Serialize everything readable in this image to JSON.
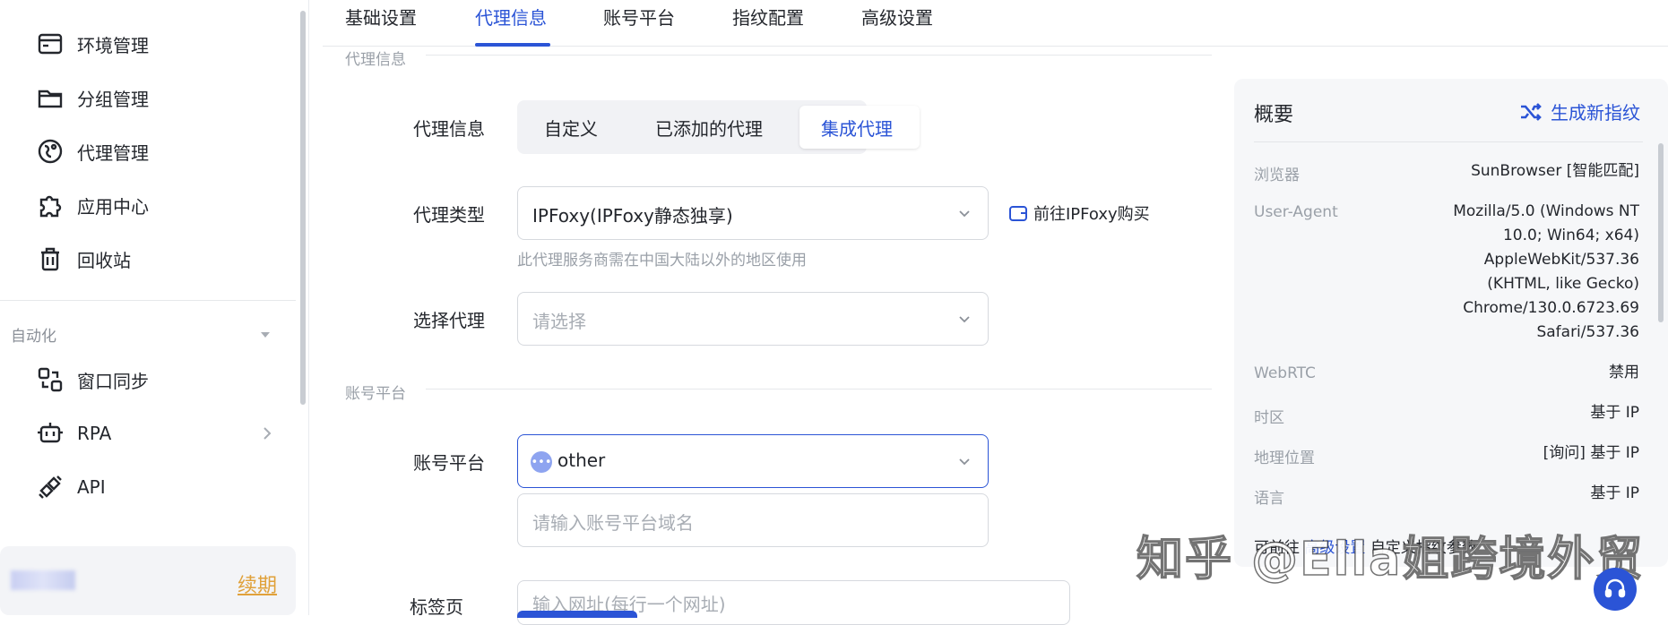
{
  "sidebar": {
    "items": [
      {
        "label": "环境管理",
        "icon": "browser-window-icon"
      },
      {
        "label": "分组管理",
        "icon": "folder-icon"
      },
      {
        "label": "代理管理",
        "icon": "proxy-globe-icon"
      },
      {
        "label": "应用中心",
        "icon": "puzzle-icon"
      },
      {
        "label": "回收站",
        "icon": "trash-icon"
      }
    ],
    "section_label": "自动化",
    "auto_items": [
      {
        "label": "窗口同步",
        "icon": "window-sync-icon"
      },
      {
        "label": "RPA",
        "icon": "robot-icon"
      },
      {
        "label": "API",
        "icon": "api-plug-icon"
      }
    ],
    "renew_label": "续期"
  },
  "tabs": [
    "基础设置",
    "代理信息",
    "账号平台",
    "指纹配置",
    "高级设置"
  ],
  "active_tab": "代理信息",
  "proxy_section": {
    "title": "代理信息",
    "proxy_info_label": "代理信息",
    "options": [
      "自定义",
      "已添加的代理",
      "集成代理"
    ],
    "selected_option": "集成代理",
    "proxy_type_label": "代理类型",
    "proxy_type_value": "IPFoxy(IPFoxy静态独享)",
    "buy_link": "前往IPFoxy购买",
    "hint": "此代理服务商需在中国大陆以外的地区使用",
    "select_proxy_label": "选择代理",
    "select_proxy_placeholder": "请选择"
  },
  "account_section": {
    "title": "账号平台",
    "platform_label": "账号平台",
    "platform_value": "other",
    "domain_placeholder": "请输入账号平台域名",
    "tab_page_label": "标签页",
    "tab_page_placeholder": "输入网址(每行一个网址)"
  },
  "overview": {
    "title": "概要",
    "generate_button": "生成新指纹",
    "rows": [
      {
        "key": "浏览器",
        "value": "SunBrowser [智能匹配]"
      },
      {
        "key": "User-Agent",
        "value": "Mozilla/5.0 (Windows NT 10.0; Win64; x64) AppleWebKit/537.36 (KHTML, like Gecko) Chrome/130.0.6723.69 Safari/537.36"
      },
      {
        "key": "WebRTC",
        "value": "禁用"
      },
      {
        "key": "时区",
        "value": "基于 IP"
      },
      {
        "key": "地理位置",
        "value": "[询问] 基于 IP"
      },
      {
        "key": "语言",
        "value": "基于 IP"
      }
    ],
    "ua_lines": [
      "Mozilla/5.0 (Windows NT",
      "10.0; Win64; x64)",
      "AppleWebKit/537.36",
      "(KHTML, like Gecko)",
      "Chrome/130.0.6723.69",
      "Safari/537.36"
    ],
    "footer_prefix": "可前往",
    "footer_link": "高级设置",
    "footer_suffix": "自定义指纹参数"
  },
  "watermark": "知乎 @Ella姐跨境外贸",
  "colors": {
    "accent": "#2b54d6",
    "renew": "#e0a13a"
  }
}
